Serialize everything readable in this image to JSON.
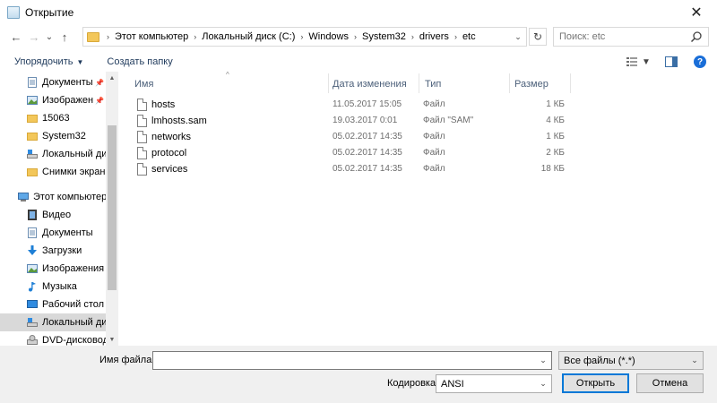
{
  "window": {
    "title": "Открытие",
    "close_glyph": "✕",
    "app_icon": "window-icon"
  },
  "nav_buttons": {
    "back": "←",
    "forward": "→",
    "recent": "⌄",
    "up": "↑"
  },
  "address": {
    "crumbs": [
      "Этот компьютер",
      "Локальный диск (C:)",
      "Windows",
      "System32",
      "drivers",
      "etc"
    ],
    "separator": "›",
    "dropdown": "⌄",
    "refresh": "↻"
  },
  "search": {
    "placeholder": "Поиск: etc"
  },
  "toolbar": {
    "organize_label": "Упорядочить",
    "organize_arrow": "▼",
    "new_folder_label": "Создать папку",
    "help_label": "?"
  },
  "nav_pane": {
    "items": [
      {
        "label": "Документы",
        "icon": "documents-icon",
        "pinned": true
      },
      {
        "label": "Изображени",
        "icon": "pictures-icon",
        "pinned": true
      },
      {
        "label": "15063",
        "icon": "folder-icon",
        "pinned": false
      },
      {
        "label": "System32",
        "icon": "folder-icon",
        "pinned": false
      },
      {
        "label": "Локальный дис",
        "icon": "drive-icon",
        "pinned": false
      },
      {
        "label": "Снимки экрана",
        "icon": "folder-icon",
        "pinned": false
      },
      {
        "label": "Этот компьютер",
        "icon": "computer-icon",
        "pinned": false
      },
      {
        "label": "Видео",
        "icon": "video-icon",
        "pinned": false
      },
      {
        "label": "Документы",
        "icon": "documents-icon",
        "pinned": false
      },
      {
        "label": "Загрузки",
        "icon": "downloads-icon",
        "pinned": false
      },
      {
        "label": "Изображения",
        "icon": "pictures-icon",
        "pinned": false
      },
      {
        "label": "Музыка",
        "icon": "music-icon",
        "pinned": false
      },
      {
        "label": "Рабочий стол",
        "icon": "desktop-icon",
        "pinned": false
      },
      {
        "label": "Локальный дис",
        "icon": "drive-icon",
        "pinned": false,
        "selected": true
      },
      {
        "label": "DVD-дисковод (",
        "icon": "dvd-icon",
        "pinned": false
      }
    ],
    "pin_glyph": "📌"
  },
  "columns": {
    "name": "Имя",
    "date": "Дата изменения",
    "type": "Тип",
    "size": "Размер",
    "sort_glyph": "^"
  },
  "files": [
    {
      "name": "hosts",
      "date": "11.05.2017 15:05",
      "type": "Файл",
      "size": "1 КБ"
    },
    {
      "name": "lmhosts.sam",
      "date": "19.03.2017 0:01",
      "type": "Файл \"SAM\"",
      "size": "4 КБ"
    },
    {
      "name": "networks",
      "date": "05.02.2017 14:35",
      "type": "Файл",
      "size": "1 КБ"
    },
    {
      "name": "protocol",
      "date": "05.02.2017 14:35",
      "type": "Файл",
      "size": "2 КБ"
    },
    {
      "name": "services",
      "date": "05.02.2017 14:35",
      "type": "Файл",
      "size": "18 КБ"
    }
  ],
  "bottom": {
    "filename_label": "Имя файла:",
    "filename_value": "",
    "filter_value": "Все файлы  (*.*)",
    "encoding_label": "Кодировка:",
    "encoding_value": "ANSI",
    "open_label": "Открыть",
    "cancel_label": "Отмена"
  }
}
